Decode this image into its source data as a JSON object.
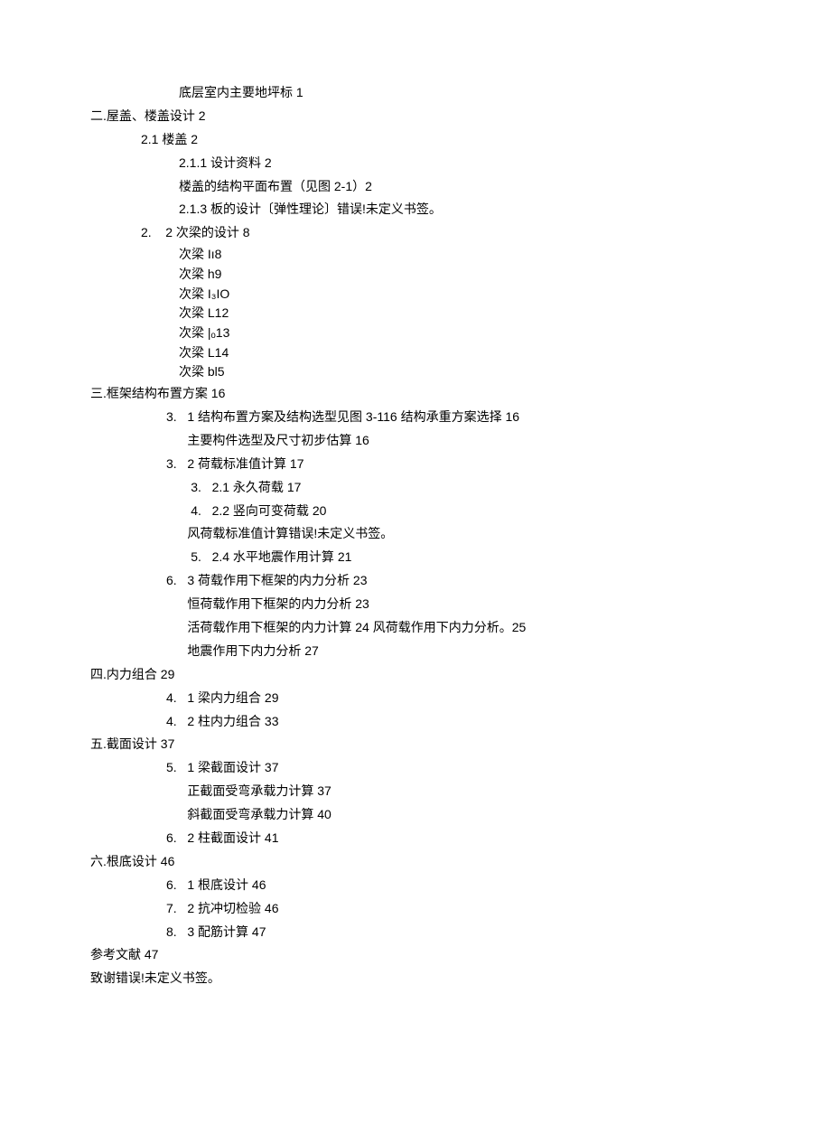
{
  "lines": [
    {
      "cls": "i3",
      "text": "底层室内主要地坪标 1"
    },
    {
      "cls": "i0",
      "text": "二.屋盖、楼盖设计 2"
    },
    {
      "cls": "i1",
      "text": "2.1 楼盖 2"
    },
    {
      "cls": "i3",
      "text": "2.1.1 设计资料 2"
    },
    {
      "cls": "i3",
      "text": "楼盖的结构平面布置（见图 2-1）2"
    },
    {
      "cls": "i3",
      "text": "2.1.3 板的设计〔弹性理论〕错误!未定义书签。"
    },
    {
      "cls": "i1",
      "text": "2.    2 次梁的设计 8"
    },
    {
      "cls": "i3 tight",
      "text": "次梁 Iı8"
    },
    {
      "cls": "i3 tight",
      "text": "次梁 h9"
    },
    {
      "cls": "i3 tight",
      "text": "次梁 I₃IO"
    },
    {
      "cls": "i3 tight",
      "text": "次梁 L12"
    },
    {
      "cls": "i3 tight",
      "text": "次梁 |ₒ13"
    },
    {
      "cls": "i3 tight",
      "text": "次梁 L14"
    },
    {
      "cls": "i3 tight",
      "text": "次梁 bl5"
    },
    {
      "cls": "i0",
      "text": "三.框架结构布置方案 16"
    },
    {
      "cls": "i2",
      "text": "3.   1 结构布置方案及结构选型见图 3-116 结构承重方案选择 16"
    },
    {
      "cls": "i2",
      "text": "      主要构件选型及尺寸初步估算 16"
    },
    {
      "cls": "i2",
      "text": "3.   2 荷载标准值计算 17"
    },
    {
      "cls": "i2",
      "text": "       3.   2.1 永久荷载 17"
    },
    {
      "cls": "i2",
      "text": "       4.   2.2 竖向可变荷载 20"
    },
    {
      "cls": "i2",
      "text": "      风荷载标准值计算错误!未定义书签。"
    },
    {
      "cls": "i2",
      "text": "       5.   2.4 水平地震作用计算 21"
    },
    {
      "cls": "i2",
      "text": "6.   3 荷载作用下框架的内力分析 23"
    },
    {
      "cls": "i2",
      "text": "      恒荷载作用下框架的内力分析 23"
    },
    {
      "cls": "i2",
      "text": "      活荷载作用下框架的内力计算 24 风荷载作用下内力分析。25"
    },
    {
      "cls": "i2",
      "text": "      地震作用下内力分析 27"
    },
    {
      "cls": "i0",
      "text": "四.内力组合 29"
    },
    {
      "cls": "i2",
      "text": "4.   1 梁内力组合 29"
    },
    {
      "cls": "i2",
      "text": "4.   2 柱内力组合 33"
    },
    {
      "cls": "i0",
      "text": "五.截面设计 37"
    },
    {
      "cls": "i2",
      "text": "5.   1 梁截面设计 37"
    },
    {
      "cls": "i2",
      "text": "      正截面受弯承载力计算 37"
    },
    {
      "cls": "i2",
      "text": "      斜截面受弯承载力计算 40"
    },
    {
      "cls": "i2",
      "text": "6.   2 柱截面设计 41"
    },
    {
      "cls": "i0",
      "text": "六.根底设计 46"
    },
    {
      "cls": "i2",
      "text": "6.   1 根底设计 46"
    },
    {
      "cls": "i2",
      "text": "7.   2 抗冲切检验 46"
    },
    {
      "cls": "i2",
      "text": "8.   3 配筋计算 47"
    },
    {
      "cls": "i0",
      "text": "参考文献 47"
    },
    {
      "cls": "i0",
      "text": "致谢错误!未定义书签。"
    }
  ]
}
